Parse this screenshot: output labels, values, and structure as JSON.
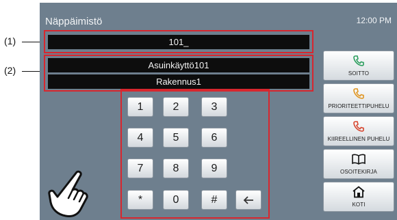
{
  "callouts": {
    "c1": "(1)",
    "c2": "(2)"
  },
  "header": {
    "title": "Näppäimistö",
    "time": "12:00 PM"
  },
  "display": {
    "input_value": "101_",
    "name": "Asuinkäyttö101",
    "building": "Rakennus1"
  },
  "keypad": {
    "keys": [
      "1",
      "2",
      "3",
      "4",
      "5",
      "6",
      "7",
      "8",
      "9",
      "*",
      "0",
      "#"
    ],
    "backspace_icon": "arrow-left-icon"
  },
  "sidebar": {
    "call": {
      "label": "SOITTO",
      "icon": "phone-icon",
      "color": "#2a9d5c"
    },
    "priority": {
      "label": "PRIORITEETTIPUHELU",
      "icon": "phone-icon",
      "color": "#e0951f"
    },
    "urgent": {
      "label": "KIIREELLINEN PUHELU",
      "icon": "phone-icon",
      "color": "#d7452e"
    },
    "directory": {
      "label": "OSOITEKIRJA",
      "icon": "book-icon"
    },
    "home": {
      "label": "KOTI",
      "icon": "home-icon"
    }
  },
  "colors": {
    "screen_bg": "#6e7f8e",
    "highlight": "#d8262e"
  }
}
